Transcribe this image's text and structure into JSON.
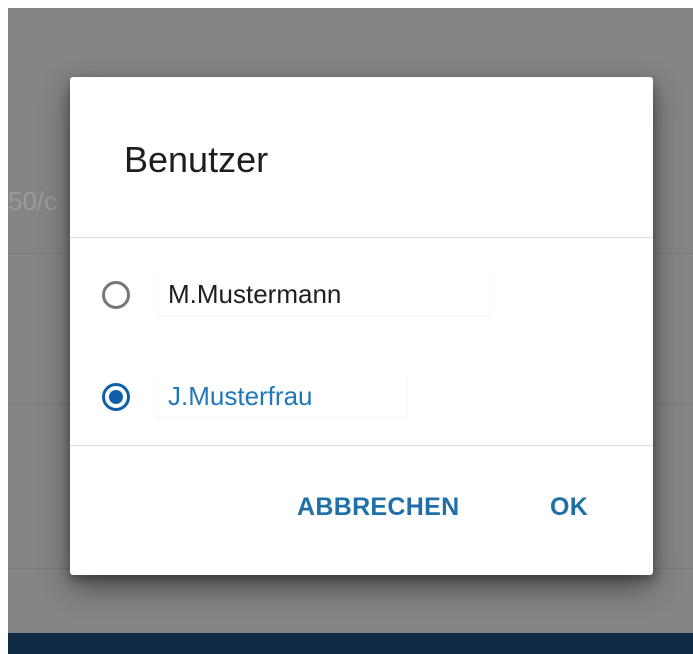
{
  "background": {
    "partial_text": "50/c"
  },
  "dialog": {
    "title": "Benutzer",
    "options": [
      {
        "label": "M.Mustermann",
        "selected": false
      },
      {
        "label": "J.Musterfrau",
        "selected": true
      }
    ],
    "cancel_label": "ABBRECHEN",
    "ok_label": "OK"
  },
  "colors": {
    "accent": "#0e5fa8",
    "selected_text": "#1f78b9",
    "scrim": "#858585",
    "bottom_bar": "#102a46"
  }
}
